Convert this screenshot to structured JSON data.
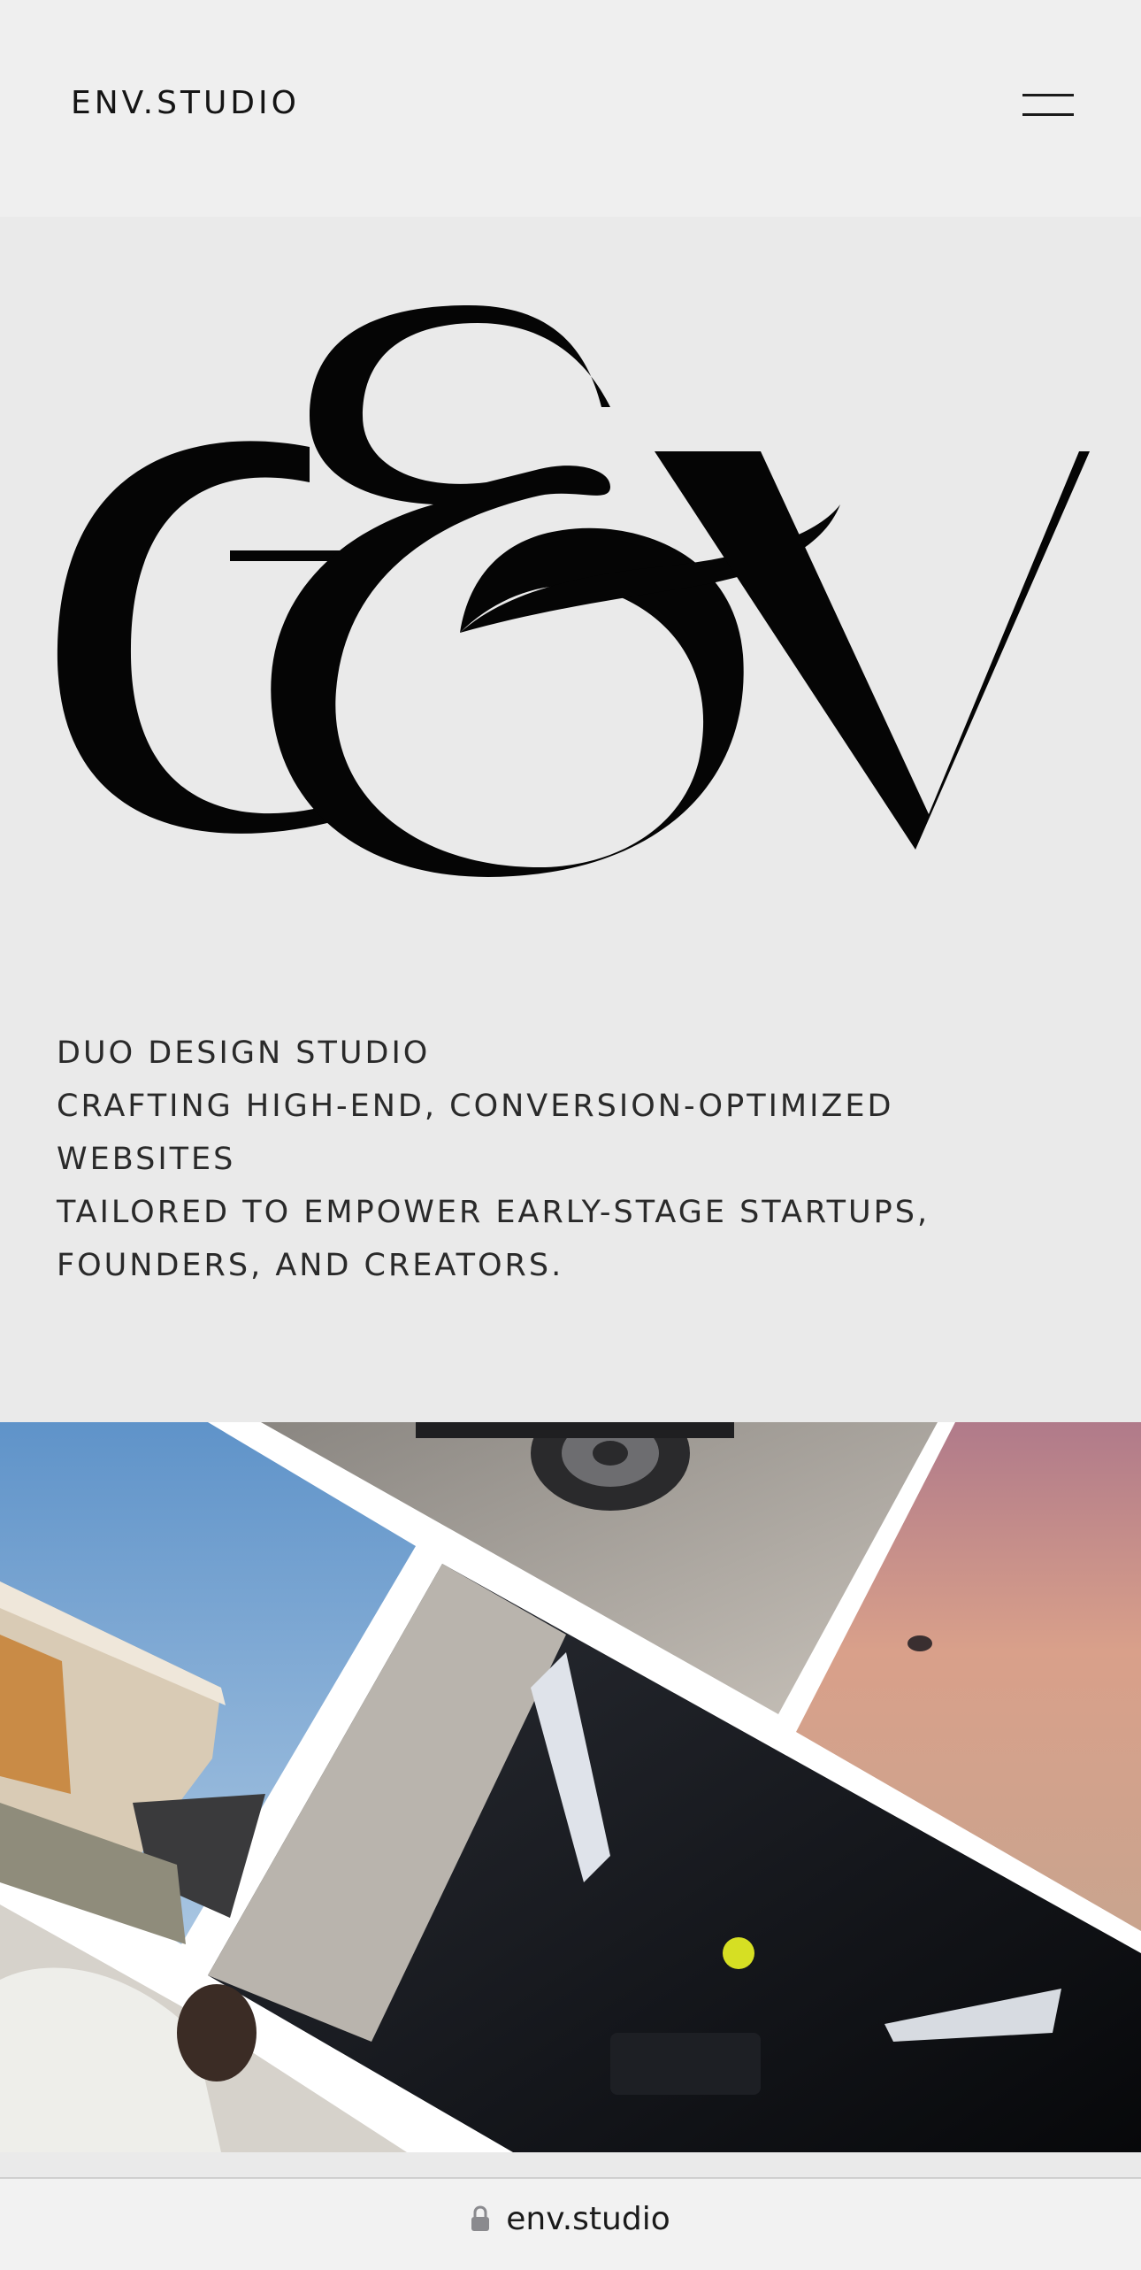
{
  "header": {
    "brand": "ENV.STUDIO",
    "menu_icon": "hamburger-icon"
  },
  "hero": {
    "logo_icon": "env-monogram-logo",
    "tagline_lines": [
      "DUO DESIGN STUDIO",
      "CRAFTING HIGH-END, CONVERSION-OPTIMIZED",
      "WEBSITES",
      "TAILORED TO EMPOWER EARLY-STAGE STARTUPS,",
      "FOUNDERS, AND CREATORS."
    ]
  },
  "gallery": {
    "images": [
      "modern-architecture-photo",
      "silver-car-wheel-photo",
      "sunset-lake-photo",
      "black-sports-car-photo",
      "person-white-shirt-photo"
    ]
  },
  "browser": {
    "lock_icon": "lock-icon",
    "url": "env.studio"
  },
  "colors": {
    "background": "#eaeaea",
    "header_bg": "#efefef",
    "text": "#151515",
    "gallery_gap": "#ffffff"
  }
}
